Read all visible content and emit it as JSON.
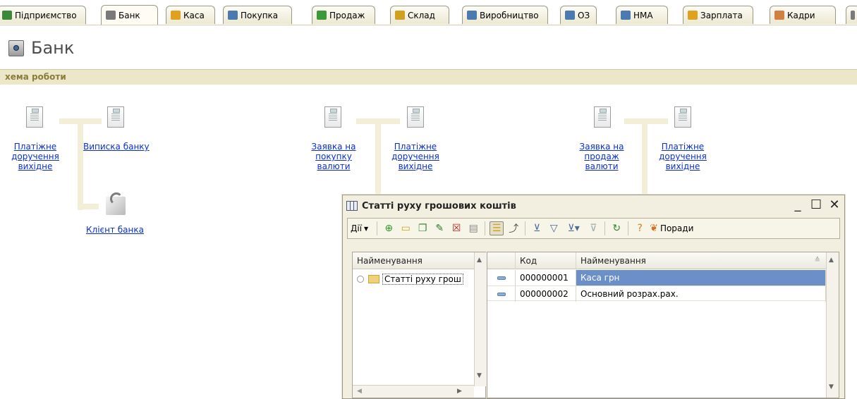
{
  "tabs": [
    {
      "label": "Підприємство",
      "icon": "enterprise-icon",
      "color": "#3a8a3a"
    },
    {
      "label": "Банк",
      "icon": "bank-icon",
      "color": "#7a7a7a",
      "active": true
    },
    {
      "label": "Каса",
      "icon": "cash-icon",
      "color": "#e0a020"
    },
    {
      "label": "Покупка",
      "icon": "purchase-icon",
      "color": "#4a7ab0"
    },
    {
      "label": "Продаж",
      "icon": "sale-icon",
      "color": "#3a9a3a"
    },
    {
      "label": "Склад",
      "icon": "warehouse-icon",
      "color": "#d0a020"
    },
    {
      "label": "Виробництво",
      "icon": "production-icon",
      "color": "#4a7ab0"
    },
    {
      "label": "ОЗ",
      "icon": "fixed-assets-icon",
      "color": "#4a7ab0"
    },
    {
      "label": "НМА",
      "icon": "intangible-icon",
      "color": "#4a7ab0"
    },
    {
      "label": "Зарплата",
      "icon": "salary-icon",
      "color": "#e0a020"
    },
    {
      "label": "Кадри",
      "icon": "staff-icon",
      "color": "#d08040"
    }
  ],
  "page": {
    "title": "Банк",
    "section_title": "хема роботи"
  },
  "scheme": {
    "group1": {
      "doc1": "Платіжне доручення вихідне",
      "doc2": "Виписка банку",
      "client": "Клієнт банка"
    },
    "group2": {
      "doc1": "Заявка на покупку валюти",
      "doc2": "Платіжне доручення вихідне"
    },
    "group3": {
      "doc1": "Заявка на продаж валюти",
      "doc2": "Платіжне доручення вихідне"
    }
  },
  "dialog": {
    "title": "Статті руху грошових коштів",
    "controls": {
      "minimize": "_",
      "maximize": "☐",
      "close": "✕"
    },
    "toolbar": {
      "actions_label": "Дії",
      "hints_label": "Поради"
    },
    "tree": {
      "header": "Найменування",
      "root_item": "Статті руху грош"
    },
    "list": {
      "columns": {
        "code": "Код",
        "name": "Найменування"
      },
      "rows": [
        {
          "code": "000000001",
          "name": "Каса грн",
          "selected": true
        },
        {
          "code": "000000002",
          "name": "Основний розрах.рах.",
          "selected": false
        }
      ]
    }
  },
  "colors": {
    "link": "#0b2fd6",
    "section_bar": "#ece7c9",
    "selected_row": "#6b8fc9"
  }
}
